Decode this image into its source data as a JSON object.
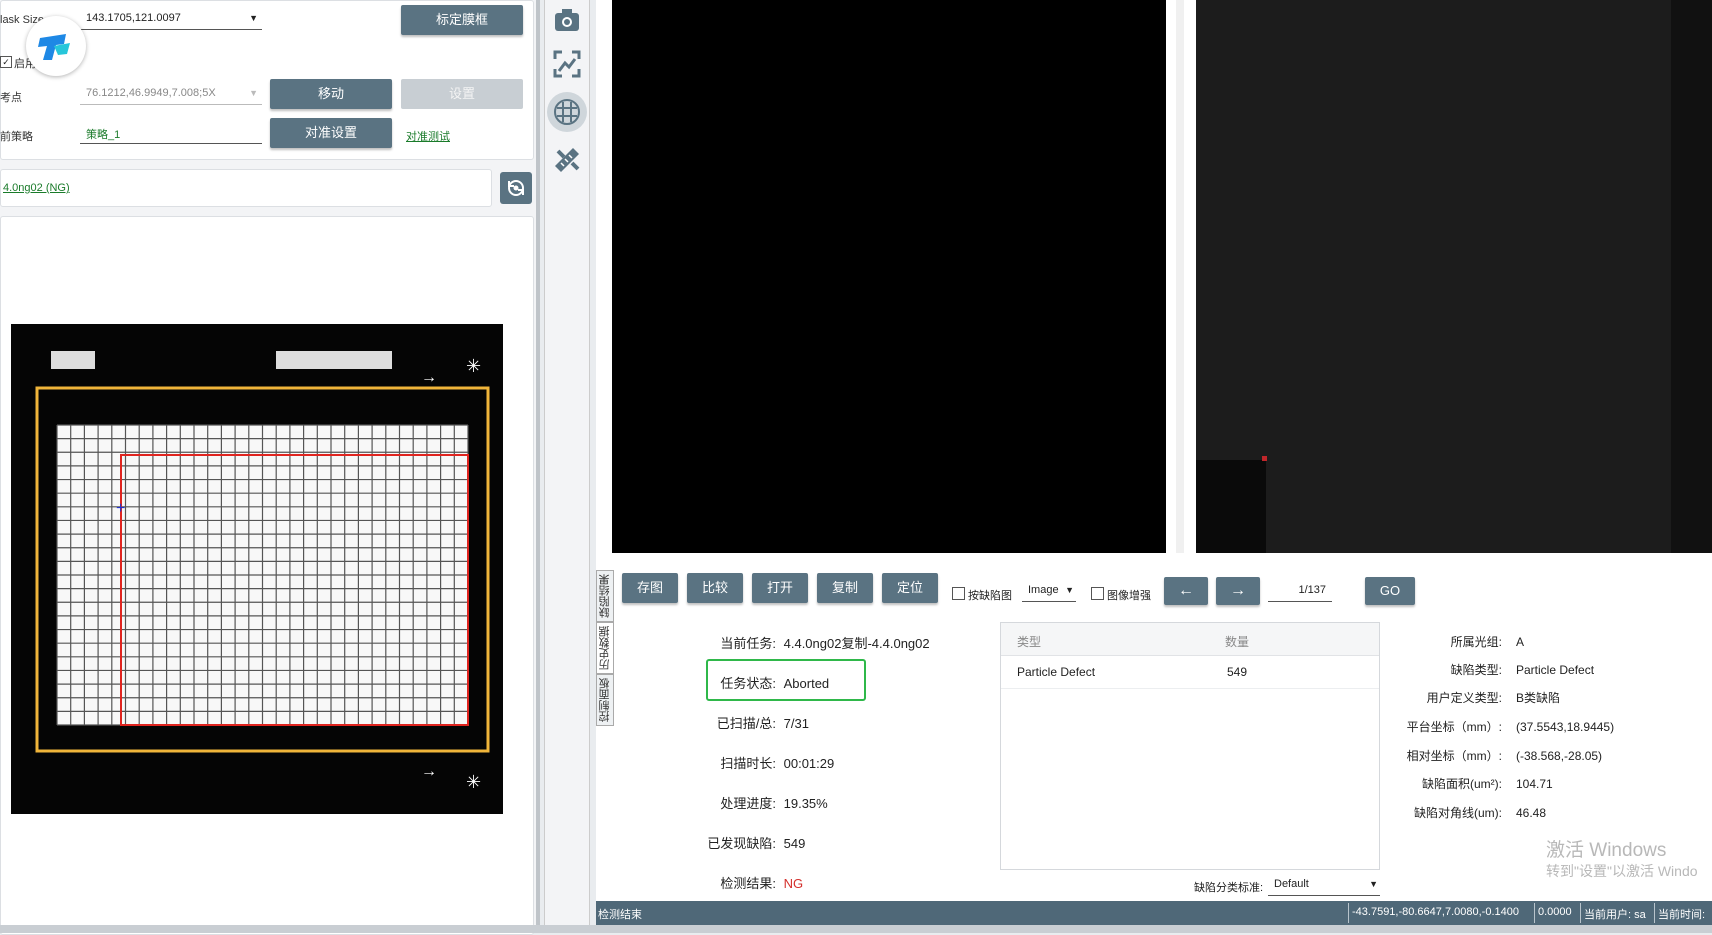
{
  "left": {
    "mask_size": {
      "label": "lask Size",
      "value": "143.1705,121.0097"
    },
    "calib_button": "标定膜框",
    "enable": {
      "label": "启用"
    },
    "ref_point": {
      "label": "考点",
      "value": "76.1212,46.9949,7.008;5X"
    },
    "move_button": "移动",
    "set_button": "设置",
    "strategy": {
      "label": "前策略",
      "value": "策略_1"
    },
    "align_button": "对准设置",
    "align_test_link": "对准测试",
    "task_link": "4.0ng02 (NG)"
  },
  "bottom": {
    "buttons": [
      "存图",
      "比较",
      "打开",
      "复制",
      "定位"
    ],
    "by_defect_label": "按缺陷图",
    "image_select": "Image",
    "enhance_label": "图像增强",
    "prev_icon": "arrow-left-icon",
    "next_icon": "arrow-right-icon",
    "page": "1/137",
    "go_button": "GO",
    "vtabs": [
      "缺陷结果",
      "历史数据",
      "控制面板"
    ],
    "info": {
      "task": {
        "key": "当前任务:",
        "value": "4.4.0ng02复制-4.4.0ng02"
      },
      "status": {
        "key": "任务状态:",
        "value": "Aborted"
      },
      "scanned": {
        "key": "已扫描/总:",
        "value": "7/31"
      },
      "duration": {
        "key": "扫描时长:",
        "value": "00:01:29"
      },
      "progress": {
        "key": "处理进度:",
        "value": "19.35%"
      },
      "defects": {
        "key": "已发现缺陷:",
        "value": "549"
      },
      "result": {
        "key": "检测结果:",
        "value": "NG"
      }
    },
    "table": {
      "headers": [
        "类型",
        "数量"
      ],
      "rows": [
        [
          "Particle Defect",
          "549"
        ]
      ]
    },
    "classify": {
      "label": "缺陷分类标准:",
      "value": "Default"
    },
    "props": {
      "group": {
        "key": "所属光组:",
        "value": "A"
      },
      "type": {
        "key": "缺陷类型:",
        "value": "Particle Defect"
      },
      "user_type": {
        "key": "用户定义类型:",
        "value": "B类缺陷"
      },
      "stage": {
        "key": "平台坐标（mm）:",
        "value": "(37.5543,18.9445)"
      },
      "relative": {
        "key": "相对坐标（mm）:",
        "value": "(-38.568,-28.05)"
      },
      "area": {
        "key": "缺陷面积(um²):",
        "value": "104.71"
      },
      "diag": {
        "key": "缺陷对角线(um):",
        "value": "46.48"
      }
    },
    "watermark": {
      "line1": "激活 Windows",
      "line2": "转到\"设置\"以激活 Windo"
    }
  },
  "statusbar": {
    "left": "检测结束",
    "coords": "-43.7591,-80.6647,7.0080,-0.1400",
    "zero": "0.0000",
    "user": "当前用户: sa",
    "time": "当前时间:"
  },
  "colors": {
    "button": "#5a7382",
    "status_ok": "#2fb84a",
    "ng": "#d4302c",
    "statusbar": "#4f6878"
  }
}
